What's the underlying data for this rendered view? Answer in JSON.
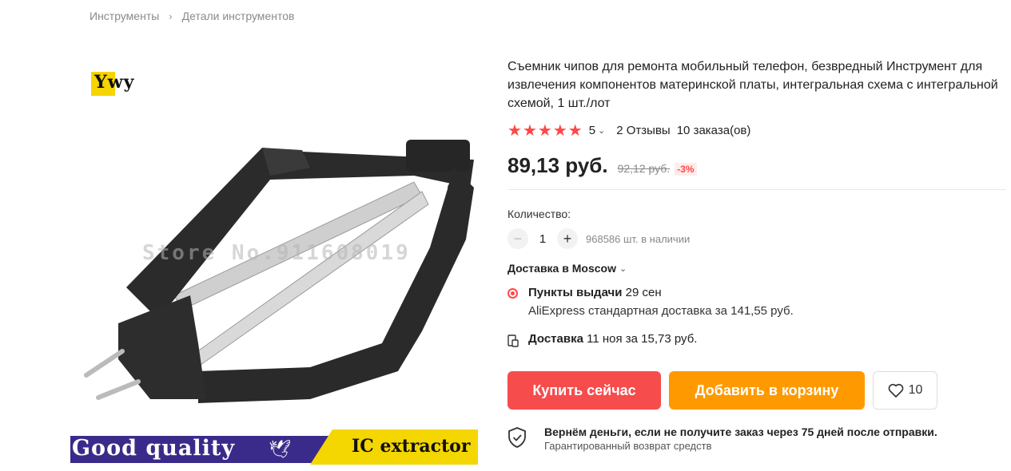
{
  "breadcrumb": {
    "items": [
      "Инструменты",
      "Детали инструментов"
    ],
    "separator": "›"
  },
  "gallery": {
    "logo": "Ywy",
    "watermark": "Store No.911608019",
    "banner_left": "Good quality",
    "banner_right": "IC extractor"
  },
  "product": {
    "title": "Съемник чипов для ремонта мобильный телефон, безвредный Инструмент для извлечения компонентов материнской платы, интегральная схема с интегральной схемой, 1 шт./лот",
    "rating": "5",
    "reviews": "2 Отзывы",
    "orders": "10 заказа(ов)",
    "price": "89,13 руб.",
    "old_price": "92,12 руб.",
    "discount": "-3%"
  },
  "quantity": {
    "label": "Количество:",
    "value": "1",
    "stock": "968586 шт. в наличии"
  },
  "delivery": {
    "to_label": "Доставка в Moscow",
    "pickup_title": "Пункты выдачи",
    "pickup_date": "29 сен",
    "pickup_sub": "AliExpress стандартная доставка за 141,55 руб.",
    "courier_title": "Доставка",
    "courier_text": "11 ноя за 15,73 руб."
  },
  "actions": {
    "buy": "Купить сейчас",
    "cart": "Добавить в корзину",
    "wishlist_count": "10"
  },
  "guarantee": {
    "title": "Вернём деньги, если не получите заказ через 75 дней после отправки.",
    "subtitle": "Гарантированный возврат средств"
  },
  "colors": {
    "accent_red": "#f64c4c",
    "accent_orange": "#fe9a00",
    "star": "#ff4747"
  }
}
